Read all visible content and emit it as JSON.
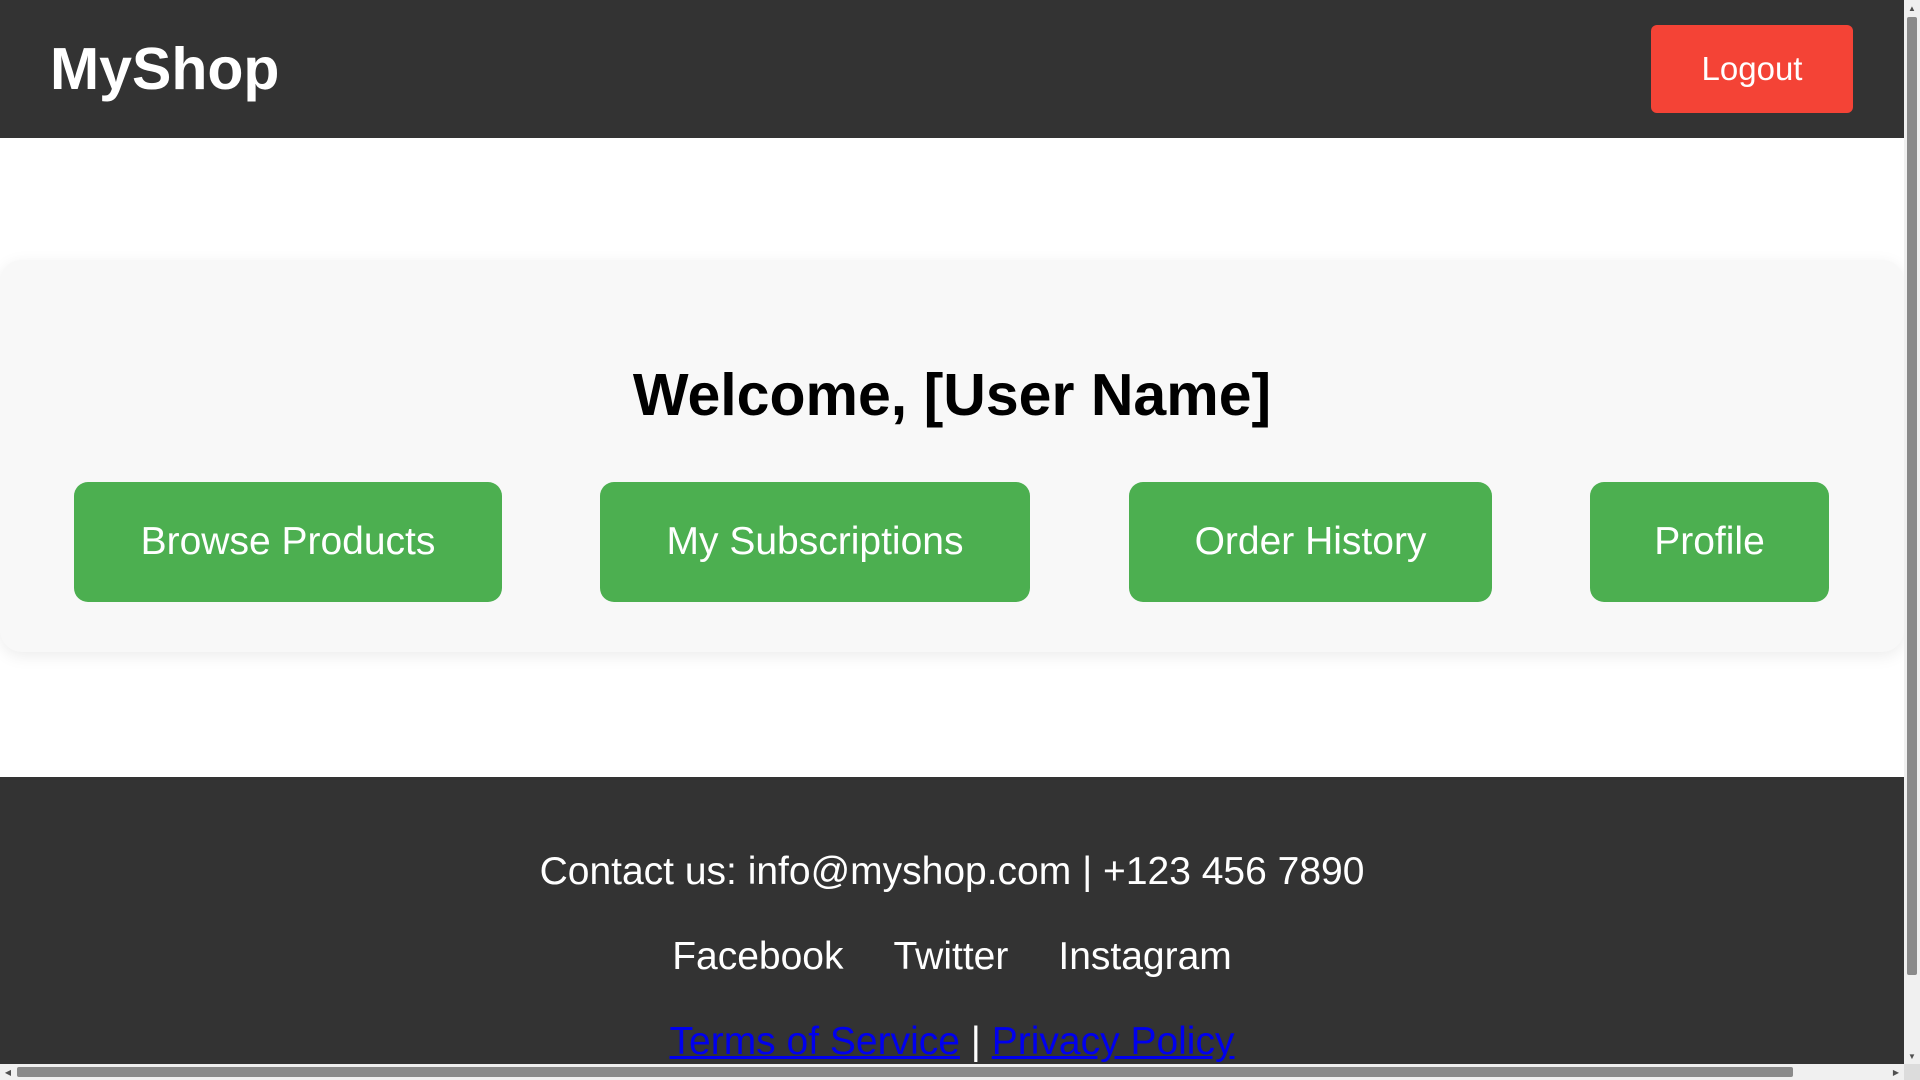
{
  "header": {
    "logo": "MyShop",
    "logout_label": "Logout"
  },
  "main": {
    "welcome": "Welcome, [User Name]",
    "actions": [
      {
        "label": "Browse Products"
      },
      {
        "label": "My Subscriptions"
      },
      {
        "label": "Order History"
      },
      {
        "label": "Profile"
      }
    ]
  },
  "footer": {
    "contact": "Contact us: info@myshop.com | +123 456 7890",
    "social": [
      {
        "label": "Facebook"
      },
      {
        "label": "Twitter"
      },
      {
        "label": "Instagram"
      }
    ],
    "legal": {
      "terms": "Terms of Service",
      "separator": "|",
      "privacy": "Privacy Policy"
    }
  },
  "scrollbars": {
    "up_icon": "▲",
    "down_icon": "▼",
    "left_icon": "◀",
    "right_icon": "▶"
  },
  "colors": {
    "header_bg": "#333333",
    "logout_bg": "#f44336",
    "action_bg": "#4caf50",
    "card_bg": "#f8f8f8",
    "link": "#0000ee"
  }
}
